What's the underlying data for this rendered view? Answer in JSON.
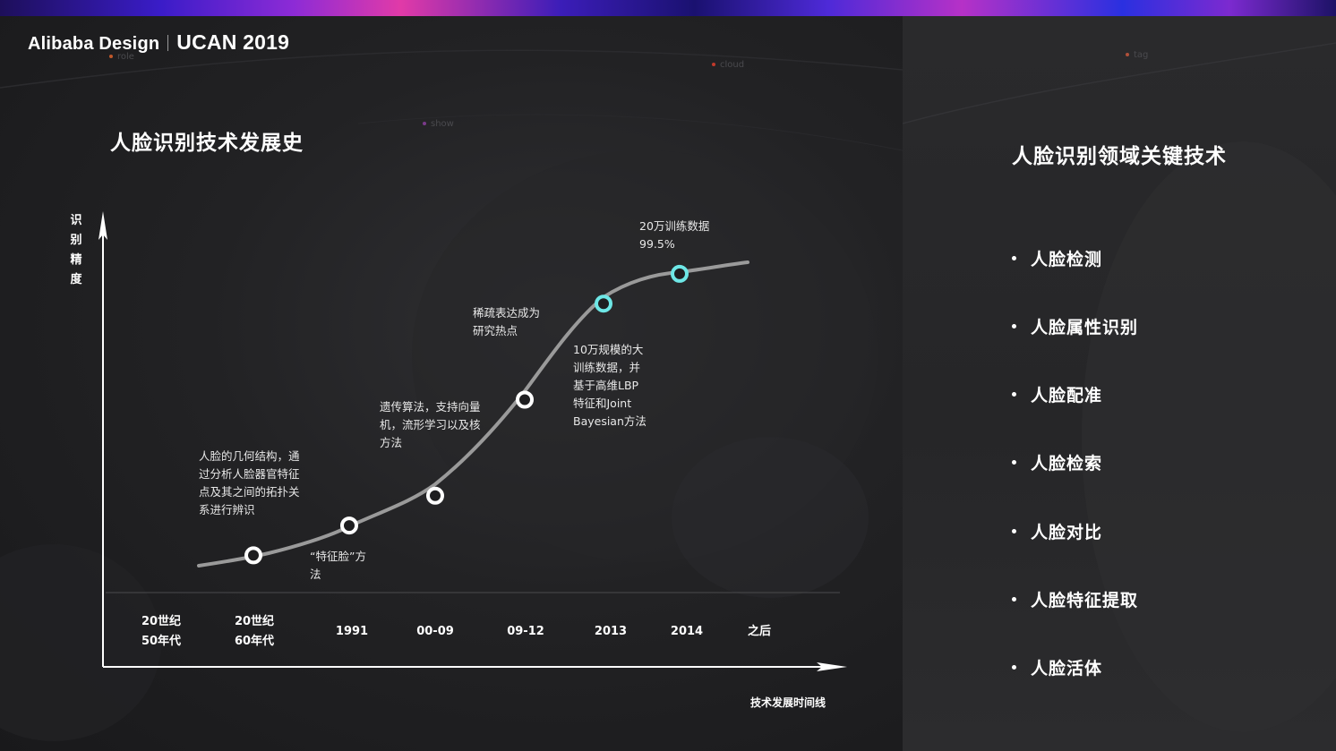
{
  "brand": {
    "company": "Alibaba Design",
    "event": "UCAN 2019"
  },
  "decor": {
    "labels": [
      "role",
      "cloud",
      "show",
      "tag"
    ]
  },
  "left": {
    "title": "人脸识别技术发展史",
    "ylabel": [
      "识",
      "别",
      "精",
      "度"
    ],
    "xlabel": "技术发展时间线"
  },
  "timeline": {
    "ticks": [
      {
        "line1": "20世纪",
        "line2": "50年代"
      },
      {
        "line1": "20世纪",
        "line2": "60年代"
      },
      {
        "line1": "1991",
        "line2": ""
      },
      {
        "line1": "00-09",
        "line2": ""
      },
      {
        "line1": "09-12",
        "line2": ""
      },
      {
        "line1": "2013",
        "line2": ""
      },
      {
        "line1": "2014",
        "line2": ""
      },
      {
        "line1": "之后",
        "line2": ""
      }
    ],
    "milestones": [
      {
        "period": "20世纪60年代",
        "accuracy_level": 0.08,
        "highlight": false
      },
      {
        "period": "1991",
        "accuracy_level": 0.17,
        "highlight": false
      },
      {
        "period": "00-09",
        "accuracy_level": 0.26,
        "highlight": false
      },
      {
        "period": "09-12",
        "accuracy_level": 0.55,
        "highlight": false
      },
      {
        "period": "2013",
        "accuracy_level": 0.84,
        "highlight": true
      },
      {
        "period": "2014",
        "accuracy_level": 0.93,
        "highlight": true
      }
    ],
    "annotations": [
      {
        "lines": [
          "人脸的几何结构，通",
          "过分析人脸器官特征",
          "点及其之间的拓扑关",
          "系进行辨识"
        ]
      },
      {
        "lines": [
          "“特征脸”方",
          "法"
        ]
      },
      {
        "lines": [
          "遗传算法，支持向量",
          "机，流形学习以及核",
          "方法"
        ]
      },
      {
        "lines": [
          "稀疏表达成为",
          "研究热点"
        ]
      },
      {
        "lines": [
          "10万规模的大",
          "训练数据，并",
          "基于高维LBP",
          "特征和Joint",
          "Bayesian方法"
        ]
      },
      {
        "lines": [
          "20万训练数据",
          "99.5%"
        ]
      }
    ]
  },
  "right": {
    "title": "人脸识别领域关键技术",
    "items": [
      "人脸检测",
      "人脸属性识别",
      "人脸配准",
      "人脸检索",
      "人脸对比",
      "人脸特征提取",
      "人脸活体"
    ]
  },
  "colors": {
    "accent": "#6ee7e6",
    "marker": "#ffffff",
    "curve": "#9a9a9a"
  }
}
